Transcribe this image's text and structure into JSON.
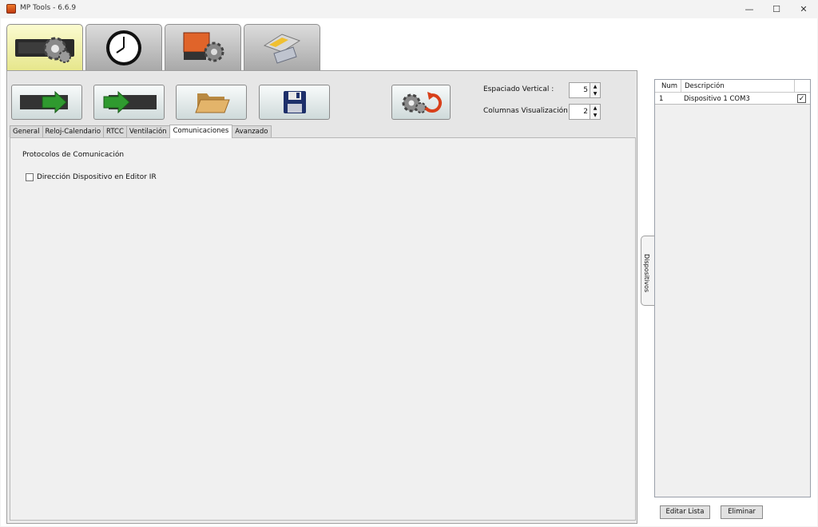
{
  "window": {
    "title": "MP Tools - 6.6.9",
    "minimize_glyph": "—",
    "maximize_glyph": "☐",
    "close_glyph": "✕"
  },
  "top_tabs": [
    {
      "id": "settings",
      "icon": "gear-settings-icon",
      "active": true
    },
    {
      "id": "clock",
      "icon": "clock-icon",
      "active": false
    },
    {
      "id": "mptools",
      "icon": "mp-tools-logo-icon",
      "active": false
    },
    {
      "id": "connector",
      "icon": "serial-connector-icon",
      "active": false
    }
  ],
  "toolbar": {
    "buttons": [
      {
        "id": "upload",
        "icon": "green-arrow-right-icon"
      },
      {
        "id": "download",
        "icon": "green-arrow-right-icon"
      },
      {
        "id": "open",
        "icon": "open-folder-icon"
      },
      {
        "id": "save",
        "icon": "floppy-disk-icon"
      },
      {
        "id": "reset",
        "icon": "gears-reset-icon"
      }
    ],
    "vertical_spacing_label": "Espaciado Vertical :",
    "vertical_spacing_value": "5",
    "columns_label": "Columnas Visualización :",
    "columns_value": "2"
  },
  "sub_tabs": [
    "General",
    "Reloj-Calendario",
    "RTCC",
    "Ventilación",
    "Comunicaciones",
    "Avanzado"
  ],
  "active_sub_tab": "Comunicaciones",
  "content": {
    "section_title": "Protocolos de Comunicación",
    "checkbox_label": "Dirección Dispositivo en Editor IR",
    "checkbox_checked": false
  },
  "devices": {
    "side_tab_label": "Dispositivos",
    "columns": [
      "Num",
      "Descripción"
    ],
    "rows": [
      {
        "num": "1",
        "description": "Dispositivo 1 COM3",
        "checked": true
      }
    ],
    "check_glyph": "✓",
    "edit_button": "Editar Lista",
    "delete_button": "Eliminar"
  }
}
